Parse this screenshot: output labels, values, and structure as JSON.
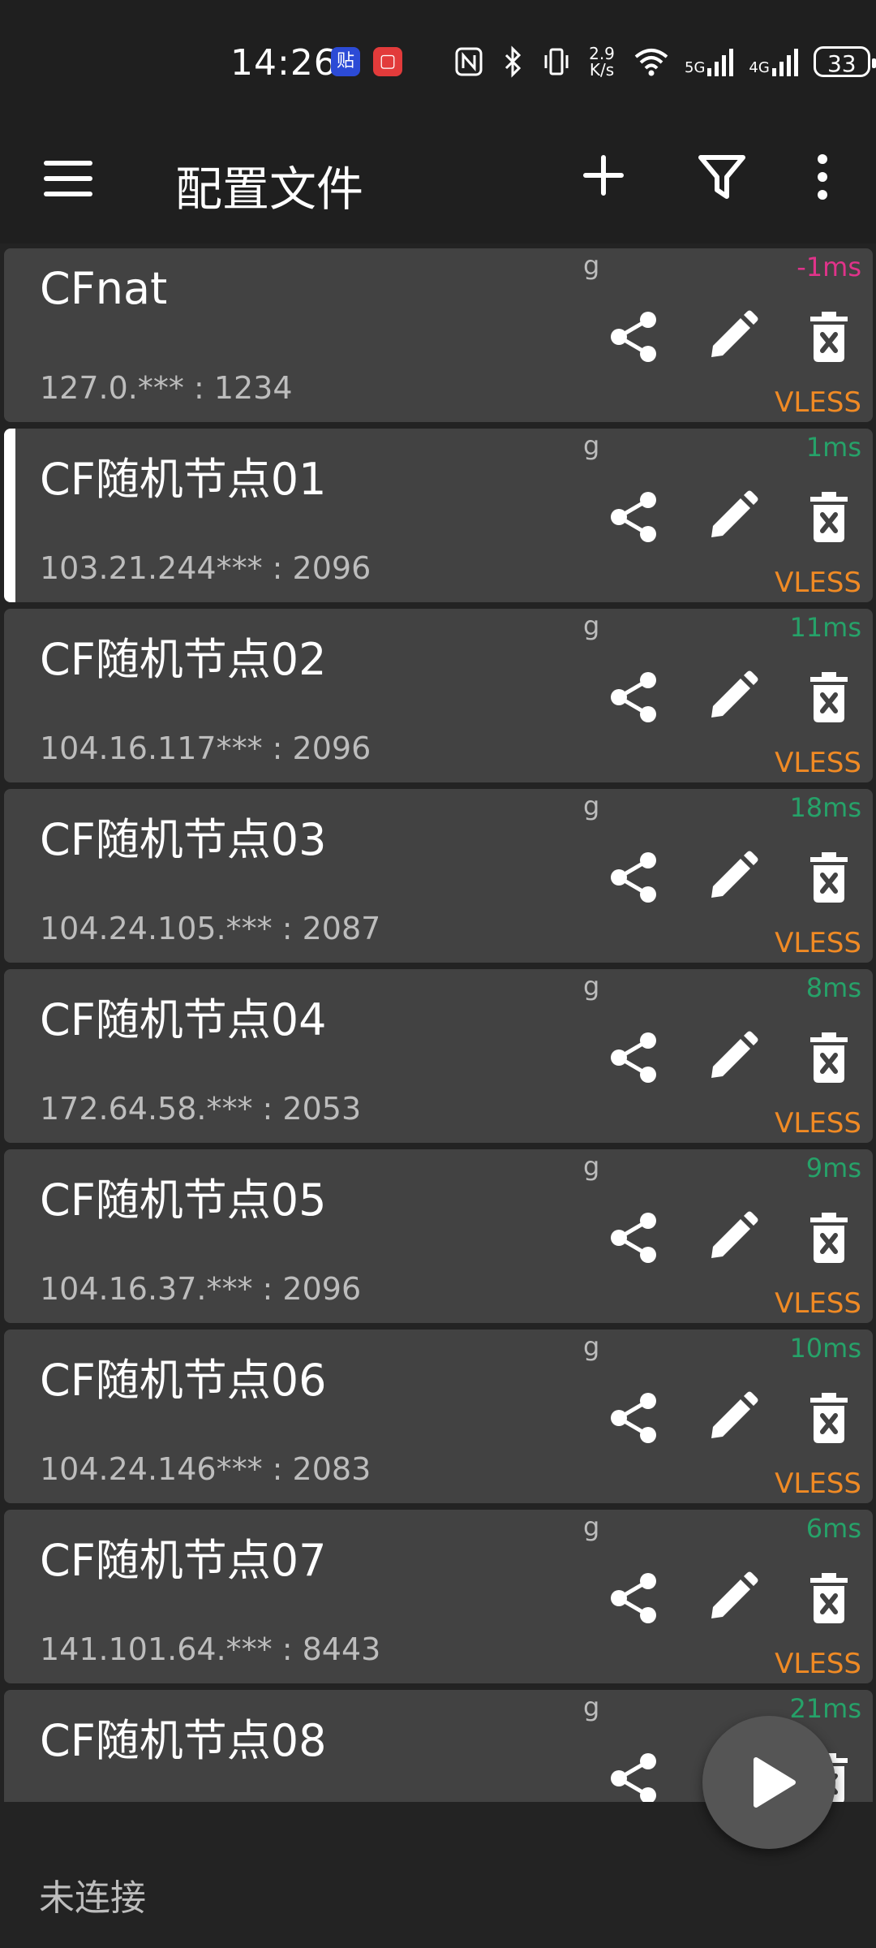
{
  "status_bar": {
    "time": "14:26",
    "app_icon_1": "贴",
    "app_icon_2": "▢",
    "speed_top": "2.9",
    "speed_bottom": "K/s",
    "net1": "5G",
    "net2": "4G",
    "battery": "33"
  },
  "appbar": {
    "title": "配置文件",
    "icons": [
      "menu-icon",
      "add-icon",
      "filter-icon",
      "more-vert-icon"
    ]
  },
  "profiles": [
    {
      "name": "CFnat",
      "address": "127.0.*** : 1234",
      "group": "g",
      "delay": "-1ms",
      "delay_color": "#e0338a",
      "type": "VLESS"
    },
    {
      "name": "CF随机节点01",
      "address": "103.21.244*** : 2096",
      "group": "g",
      "delay": "1ms",
      "delay_color": "#26a269",
      "type": "VLESS",
      "selected": true
    },
    {
      "name": "CF随机节点02",
      "address": "104.16.117*** : 2096",
      "group": "g",
      "delay": "11ms",
      "delay_color": "#26a269",
      "type": "VLESS"
    },
    {
      "name": "CF随机节点03",
      "address": "104.24.105.*** : 2087",
      "group": "g",
      "delay": "18ms",
      "delay_color": "#26a269",
      "type": "VLESS"
    },
    {
      "name": "CF随机节点04",
      "address": "172.64.58.*** : 2053",
      "group": "g",
      "delay": "8ms",
      "delay_color": "#26a269",
      "type": "VLESS"
    },
    {
      "name": "CF随机节点05",
      "address": "104.16.37.*** : 2096",
      "group": "g",
      "delay": "9ms",
      "delay_color": "#26a269",
      "type": "VLESS"
    },
    {
      "name": "CF随机节点06",
      "address": "104.24.146*** : 2083",
      "group": "g",
      "delay": "10ms",
      "delay_color": "#26a269",
      "type": "VLESS"
    },
    {
      "name": "CF随机节点07",
      "address": "141.101.64.*** : 8443",
      "group": "g",
      "delay": "6ms",
      "delay_color": "#26a269",
      "type": "VLESS"
    },
    {
      "name": "CF随机节点08",
      "address": "",
      "group": "g",
      "delay": "21ms",
      "delay_color": "#26a269",
      "type": ""
    }
  ],
  "bottom": {
    "connection_status": "未连接",
    "fab_icon": "play-icon"
  },
  "colors": {
    "background": "#232323",
    "card": "#424242",
    "delay_ok": "#26a269",
    "delay_bad": "#e0338a",
    "type_label": "#f08a24"
  }
}
